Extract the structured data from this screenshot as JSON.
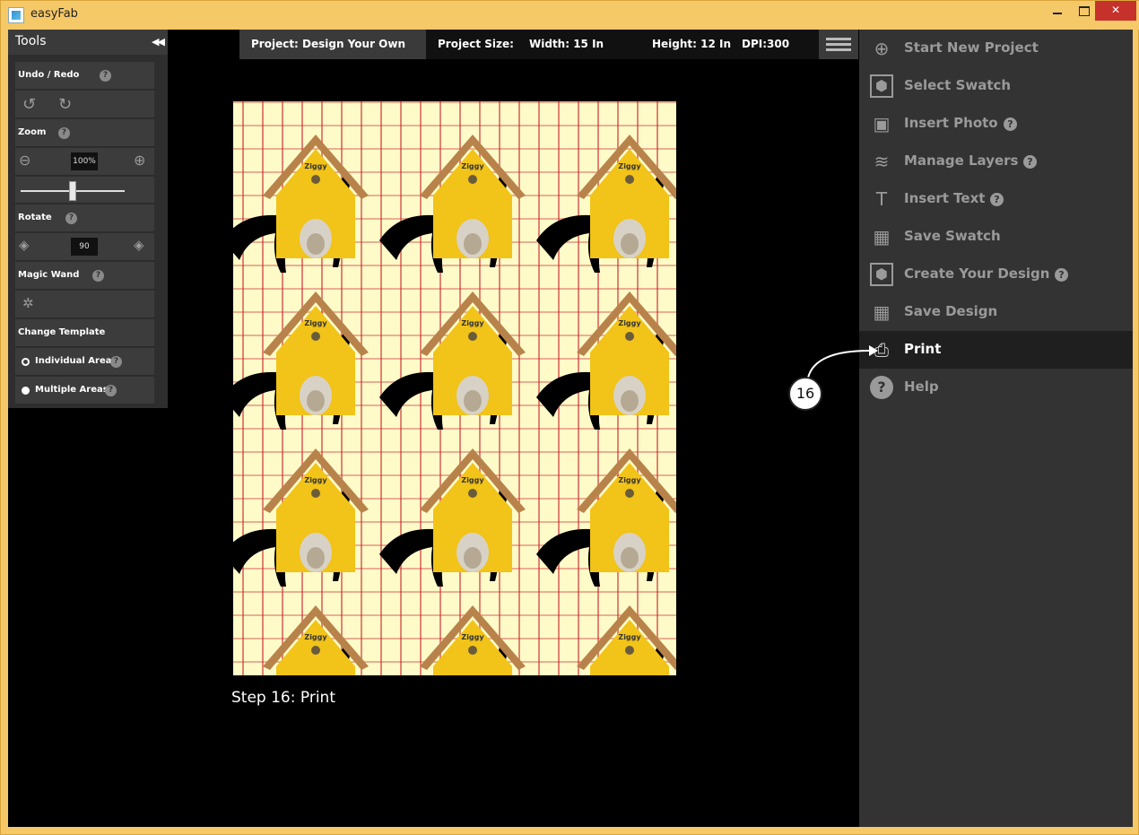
{
  "window": {
    "title": "easyFab"
  },
  "tools": {
    "title": "Tools",
    "sections": {
      "undo_redo": "Undo / Redo",
      "zoom": "Zoom",
      "zoom_value": "100%",
      "rotate": "Rotate",
      "rotate_value": "90",
      "magic_wand": "Magic Wand",
      "change_template": "Change Template",
      "individual_area": "Individual Area",
      "multiple_areas": "Multiple Areas"
    },
    "help_glyph": "?"
  },
  "project_bar": {
    "project": "Project: Design Your Own",
    "size_label": "Project Size:",
    "width": "Width: 15 In",
    "height": "Height: 12 In",
    "dpi": "DPI:300"
  },
  "canvas": {
    "house_label": "Ziggy",
    "colors": {
      "background": "#fffbc9",
      "bones": "#c81e28",
      "house": "#f2c318",
      "roof": "#b8834a",
      "silhouette": "#000000"
    }
  },
  "caption": "Step 16: Print",
  "menu": {
    "items": [
      {
        "label": "Start New Project",
        "icon": "plus-circle-icon",
        "help": false
      },
      {
        "label": "Select Swatch",
        "icon": "hexagon-icon",
        "help": false
      },
      {
        "label": "Insert Photo",
        "icon": "photo-icon",
        "help": true
      },
      {
        "label": "Manage Layers",
        "icon": "layers-icon",
        "help": true
      },
      {
        "label": "Insert Text",
        "icon": "text-icon",
        "help": true
      },
      {
        "label": "Save Swatch",
        "icon": "save-grid-icon",
        "help": false
      },
      {
        "label": "Create Your Design",
        "icon": "hexagon-icon",
        "help": true
      },
      {
        "label": "Save Design",
        "icon": "save-grid-icon",
        "help": false
      },
      {
        "label": "Print",
        "icon": "printer-icon",
        "help": false,
        "active": true
      },
      {
        "label": "Help",
        "icon": "help-circle-icon",
        "help": false
      }
    ]
  },
  "callout": "16"
}
